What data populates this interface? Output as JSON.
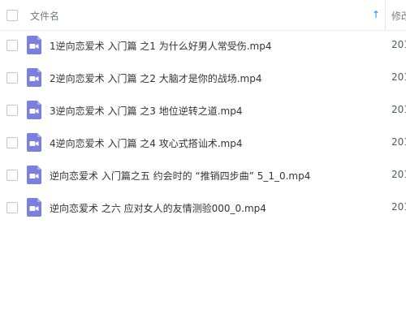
{
  "header": {
    "name_label": "文件名",
    "modified_label": "修改",
    "sort_icon": "sort-asc-arrow-icon"
  },
  "colors": {
    "accent": "#2b8cf0",
    "file_icon": "#7b7fe0"
  },
  "files": [
    {
      "name": "1逆向恋爱术 入门篇 之1 为什么好男人常受伤.mp4",
      "modified": "201"
    },
    {
      "name": "2逆向恋爱术 入门篇 之2  大脑才是你的战场.mp4",
      "modified": "201"
    },
    {
      "name": "3逆向恋爱术 入门篇 之3 地位逆转之道.mp4",
      "modified": "201"
    },
    {
      "name": "4逆向恋爱术 入门篇 之4 攻心式搭讪术.mp4",
      "modified": "201"
    },
    {
      "name": "逆向恋爱术 入门篇之五 约会时的 “推销四步曲” 5_1_0.mp4",
      "modified": "201"
    },
    {
      "name": "逆向恋爱术 之六 应对女人的友情测验000_0.mp4",
      "modified": "201"
    }
  ]
}
